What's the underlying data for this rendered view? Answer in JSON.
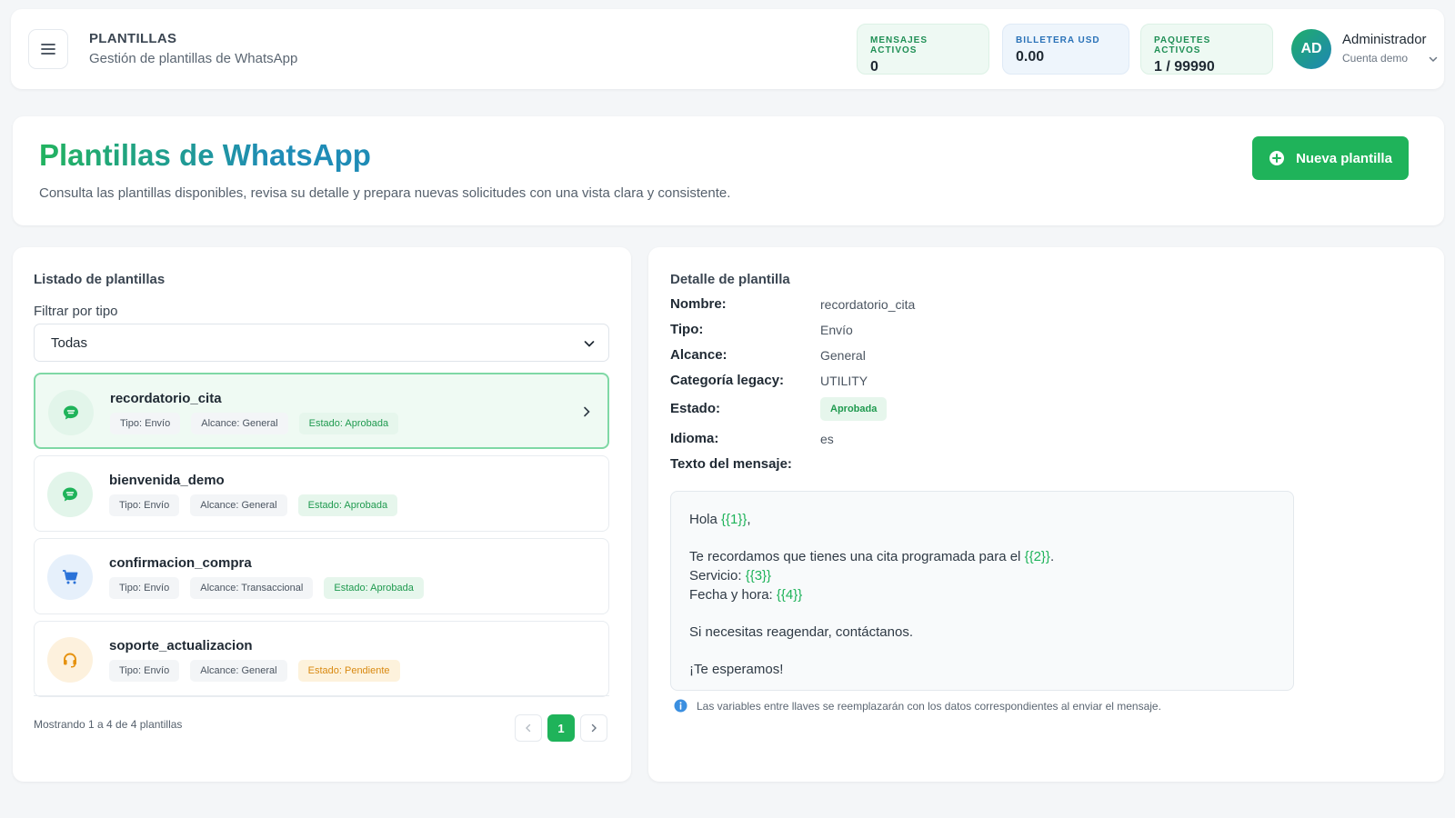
{
  "header": {
    "section": "PLANTILLAS",
    "subtitle": "Gestión de plantillas de WhatsApp",
    "stats": [
      {
        "label": "MENSAJES ACTIVOS",
        "value": "0"
      },
      {
        "label": "BILLETERA USD",
        "value": "0.00"
      },
      {
        "label": "PAQUETES ACTIVOS",
        "value": "1 / 99990"
      }
    ],
    "user": {
      "initials": "AD",
      "name": "Administrador",
      "role": "Cuenta demo"
    }
  },
  "hero": {
    "title": "Plantillas de WhatsApp",
    "description": "Consulta las plantillas disponibles, revisa su detalle y prepara nuevas solicitudes con una vista clara y consistente.",
    "new_button": "Nueva plantilla"
  },
  "list": {
    "title": "Listado de plantillas",
    "filter_label": "Filtrar por tipo",
    "filter_value": "Todas",
    "items": [
      {
        "name": "recordatorio_cita",
        "tipo": "Tipo: Envío",
        "alcance": "Alcance: General",
        "estado": "Estado: Aprobada",
        "icon": "chat-icon",
        "active": true
      },
      {
        "name": "bienvenida_demo",
        "tipo": "Tipo: Envío",
        "alcance": "Alcance: General",
        "estado": "Estado: Aprobada",
        "icon": "chat-icon"
      },
      {
        "name": "confirmacion_compra",
        "tipo": "Tipo: Envío",
        "alcance": "Alcance: Transaccional",
        "estado": "Estado: Aprobada",
        "icon": "cart-icon"
      },
      {
        "name": "soporte_actualizacion",
        "tipo": "Tipo: Envío",
        "alcance": "Alcance: General",
        "estado": "Estado: Pendiente",
        "icon": "headset-icon"
      }
    ],
    "showing": "Mostrando 1 a 4 de 4 plantillas",
    "current_page": "1"
  },
  "detail": {
    "title": "Detalle de plantilla",
    "fields": [
      {
        "label": "Nombre:",
        "value": "recordatorio_cita"
      },
      {
        "label": "Tipo:",
        "value": "Envío"
      },
      {
        "label": "Alcance:",
        "value": "General"
      },
      {
        "label": "Categoría legacy:",
        "value": "UTILITY"
      },
      {
        "label": "Estado:",
        "value": "Aprobada"
      },
      {
        "label": "Idioma:",
        "value": "es"
      }
    ],
    "message_label": "Texto del mensaje:",
    "message": {
      "l1a": "Hola ",
      "v1": "{{1}}",
      "l1b": ",",
      "l2a": "Te recordamos que tienes una cita programada para el ",
      "v2": "{{2}}",
      "l2b": ".",
      "l3a": "Servicio: ",
      "v3": "{{3}}",
      "l4a": "Fecha y hora: ",
      "v4": "{{4}}",
      "l5": "Si necesitas reagendar, contáctanos.",
      "l6": "¡Te esperamos!"
    },
    "note": "Las variables entre llaves se reemplazarán con los datos correspondientes al enviar el mensaje."
  }
}
